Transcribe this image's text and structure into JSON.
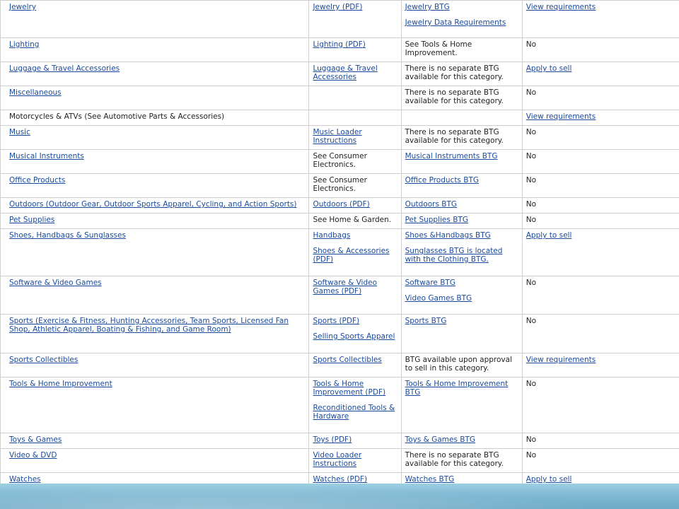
{
  "rows": [
    {
      "height": 53,
      "c1": [
        {
          "text": "Jewelry",
          "link": true
        }
      ],
      "c2": [
        {
          "text": "Jewelry (PDF)",
          "link": true
        }
      ],
      "c3": [
        {
          "text": "Jewelry BTG",
          "link": true
        },
        {
          "text": "Jewelry Data Requirements",
          "link": true
        }
      ],
      "c4": [
        {
          "text": "View requirements",
          "link": true
        }
      ]
    },
    {
      "height": 34,
      "c1": [
        {
          "text": "Lighting",
          "link": true
        }
      ],
      "c2": [
        {
          "text": "Lighting (PDF)",
          "link": true
        }
      ],
      "c3": [
        {
          "text": "See Tools & Home Improvement.",
          "link": false
        }
      ],
      "c4": [
        {
          "text": "No",
          "link": false
        }
      ]
    },
    {
      "height": 34,
      "c1": [
        {
          "text": "Luggage & Travel Accessories",
          "link": true
        }
      ],
      "c2": [
        {
          "text": "Luggage & Travel Accessories",
          "link": true
        }
      ],
      "c3": [
        {
          "text": "There is no separate BTG available for this category.",
          "link": false
        }
      ],
      "c4": [
        {
          "text": "Apply to sell",
          "link": true
        }
      ]
    },
    {
      "height": 34,
      "c1": [
        {
          "text": "Miscellaneous",
          "link": true
        }
      ],
      "c2": [],
      "c3": [
        {
          "text": "There is no separate BTG available for this category.",
          "link": false
        }
      ],
      "c4": [
        {
          "text": "No",
          "link": false
        }
      ]
    },
    {
      "height": 22,
      "c1": [
        {
          "text": "Motorcycles & ATVs (See Automotive Parts & Accessories)",
          "link": false
        }
      ],
      "c2": [],
      "c3": [],
      "c4": [
        {
          "text": "View requirements",
          "link": true
        }
      ]
    },
    {
      "height": 34,
      "c1": [
        {
          "text": "Music",
          "link": true
        }
      ],
      "c2": [
        {
          "text": "Music Loader Instructions",
          "link": true
        }
      ],
      "c3": [
        {
          "text": "There is no separate BTG available for this category.",
          "link": false
        }
      ],
      "c4": [
        {
          "text": "No",
          "link": false
        }
      ]
    },
    {
      "height": 34,
      "c1": [
        {
          "text": "Musical Instruments",
          "link": true
        }
      ],
      "c2": [
        {
          "text": "See Consumer Electronics.",
          "link": false
        }
      ],
      "c3": [
        {
          "text": "Musical Instruments BTG",
          "link": true
        }
      ],
      "c4": [
        {
          "text": "No",
          "link": false
        }
      ]
    },
    {
      "height": 34,
      "c1": [
        {
          "text": "Office Products",
          "link": true
        }
      ],
      "c2": [
        {
          "text": "See Consumer Electronics.",
          "link": false
        }
      ],
      "c3": [
        {
          "text": "Office Products BTG",
          "link": true
        }
      ],
      "c4": [
        {
          "text": "No",
          "link": false
        }
      ]
    },
    {
      "height": 22,
      "c1": [
        {
          "text": "Outdoors (Outdoor Gear, Outdoor Sports Apparel, Cycling, and Action Sports)",
          "link": true
        }
      ],
      "c2": [
        {
          "text": "Outdoors (PDF)",
          "link": true
        }
      ],
      "c3": [
        {
          "text": "Outdoors BTG",
          "link": true
        }
      ],
      "c4": [
        {
          "text": "No",
          "link": false
        }
      ]
    },
    {
      "height": 22,
      "c1": [
        {
          "text": "Pet Supplies",
          "link": true
        }
      ],
      "c2": [
        {
          "text": "See Home & Garden.",
          "link": false
        }
      ],
      "c3": [
        {
          "text": "Pet Supplies BTG",
          "link": true
        }
      ],
      "c4": [
        {
          "text": "No",
          "link": false
        }
      ]
    },
    {
      "height": 67,
      "c1": [
        {
          "text": "Shoes, Handbags & Sunglasses",
          "link": true
        }
      ],
      "c2": [
        {
          "text": "Handbags",
          "link": true
        },
        {
          "text": "Shoes & Accessories (PDF)",
          "link": true
        }
      ],
      "c3": [
        {
          "text": "Shoes &Handbags BTG",
          "link": true
        },
        {
          "text": "Sunglasses BTG is located with the Clothing BTG.",
          "link": true
        }
      ],
      "c4": [
        {
          "text": "Apply to sell",
          "link": true
        }
      ]
    },
    {
      "height": 54,
      "c1": [
        {
          "text": "Software & Video Games",
          "link": true
        }
      ],
      "c2": [
        {
          "text": "Software & Video Games (PDF)",
          "link": true
        }
      ],
      "c3": [
        {
          "text": "Software BTG",
          "link": true
        },
        {
          "text": "Video Games BTG",
          "link": true
        }
      ],
      "c4": [
        {
          "text": "No",
          "link": false
        }
      ]
    },
    {
      "height": 55,
      "c1": [
        {
          "text": "Sports (Exercise & Fitness, Hunting Accessories, Team Sports, Licensed Fan Shop, Athletic Apparel, Boating & Fishing, and Game Room)",
          "link": true
        }
      ],
      "c2": [
        {
          "text": "Sports (PDF)",
          "link": true
        },
        {
          "text": "Selling Sports Apparel",
          "link": true
        }
      ],
      "c3": [
        {
          "text": "Sports BTG",
          "link": true
        }
      ],
      "c4": [
        {
          "text": "No",
          "link": false
        }
      ]
    },
    {
      "height": 34,
      "c1": [
        {
          "text": "Sports Collectibles",
          "link": true
        }
      ],
      "c2": [
        {
          "text": "Sports Collectibles",
          "link": true
        }
      ],
      "c3": [
        {
          "text": "BTG available upon approval to sell in this category.",
          "link": false
        }
      ],
      "c4": [
        {
          "text": "View requirements",
          "link": true
        }
      ]
    },
    {
      "height": 79,
      "c1": [
        {
          "text": "Tools & Home Improvement",
          "link": true
        }
      ],
      "c2": [
        {
          "text": "Tools & Home Improvement (PDF)",
          "link": true
        },
        {
          "text": "Reconditioned Tools & Hardware",
          "link": true
        }
      ],
      "c3": [
        {
          "text": "Tools & Home Improvement BTG",
          "link": true
        }
      ],
      "c4": [
        {
          "text": "No",
          "link": false
        }
      ]
    },
    {
      "height": 22,
      "c1": [
        {
          "text": "Toys & Games",
          "link": true
        }
      ],
      "c2": [
        {
          "text": "Toys (PDF)",
          "link": true
        }
      ],
      "c3": [
        {
          "text": "Toys & Games BTG",
          "link": true
        }
      ],
      "c4": [
        {
          "text": "No",
          "link": false
        }
      ]
    },
    {
      "height": 34,
      "c1": [
        {
          "text": "Video & DVD",
          "link": true
        }
      ],
      "c2": [
        {
          "text": "Video Loader Instructions",
          "link": true
        }
      ],
      "c3": [
        {
          "text": "There is no separate BTG available for this category.",
          "link": false
        }
      ],
      "c4": [
        {
          "text": "No",
          "link": false
        }
      ]
    },
    {
      "height": 22,
      "c1": [
        {
          "text": "Watches",
          "link": true
        }
      ],
      "c2": [
        {
          "text": "Watches (PDF)",
          "link": true
        }
      ],
      "c3": [
        {
          "text": "Watches BTG",
          "link": true
        }
      ],
      "c4": [
        {
          "text": "Apply to sell",
          "link": true
        }
      ]
    }
  ],
  "colors": {
    "link": "#1a4a9c",
    "border": "#cfcfcf",
    "band_top": "#9dcfe2",
    "band_bottom": "#6eaac6"
  }
}
